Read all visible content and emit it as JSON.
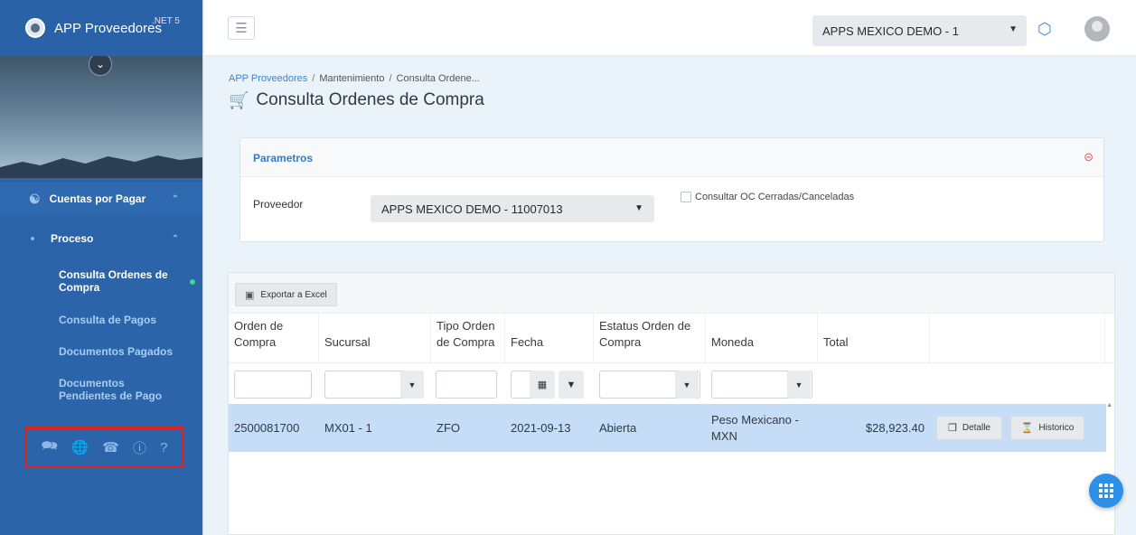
{
  "sidebar": {
    "app_title": "APP Proveedores",
    "version_badge": ".NET 5",
    "menu": {
      "section_label": "Cuentas por Pagar",
      "group_label": "Proceso",
      "items": [
        {
          "label": "Consulta Ordenes de Compra",
          "active": true
        },
        {
          "label": "Consulta de Pagos",
          "active": false
        },
        {
          "label": "Documentos Pagados",
          "active": false
        },
        {
          "label": "Documentos Pendientes de Pago",
          "active": false
        }
      ]
    },
    "footer_icons": [
      "chat-icon",
      "globe-icon",
      "phone-icon",
      "info-icon",
      "help-icon"
    ]
  },
  "topbar": {
    "company_select": "APPS MEXICO DEMO - 1",
    "menu_icon": "hamburger-icon",
    "cube_icon": "cube-icon"
  },
  "breadcrumb": [
    "APP Proveedores",
    "Mantenimiento",
    "Consulta Ordene..."
  ],
  "page_title": "Consulta Ordenes de Compra",
  "params": {
    "title": "Parametros",
    "proveedor_label": "Proveedor",
    "proveedor_value": "APPS MEXICO DEMO - 11007013",
    "checkbox_label": "Consultar OC Cerradas/Canceladas"
  },
  "grid": {
    "export_label": "Exportar a Excel",
    "columns": [
      "Orden de Compra",
      "Sucursal",
      "Tipo Orden de Compra",
      "Fecha",
      "Estatus Orden de Compra",
      "Moneda",
      "Total"
    ],
    "rows": [
      {
        "orden": "2500081700",
        "sucursal": "MX01 - 1",
        "tipo": "ZFO",
        "fecha": "2021-09-13",
        "estatus": "Abierta",
        "moneda": "Peso Mexicano - MXN",
        "total": "$28,923.40",
        "detalle_label": "Detalle",
        "historico_label": "Historico"
      }
    ]
  },
  "colors": {
    "sidebar_bg": "#2c64aa",
    "accent": "#2f7bd0",
    "selected_row": "#c6ddf8",
    "highlight_box": "#e0201d"
  }
}
